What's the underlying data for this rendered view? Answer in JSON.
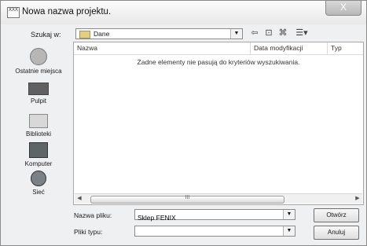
{
  "dialog": {
    "title": "Nowa nazwa projektu.",
    "app_icon_text": "XXX",
    "close_label": "X",
    "look_in_label": "Szukaj w:",
    "look_in_value": "Dane",
    "up_folder_label": "⇦",
    "new_folder_label": "⌘",
    "view_menu_label": "☰▾"
  },
  "places": [
    {
      "label": "Ostatnie miejsca",
      "icon": "recent-places-icon"
    },
    {
      "label": "Pulpit",
      "icon": "desktop-icon"
    },
    {
      "label": "Biblioteki",
      "icon": "libraries-icon"
    },
    {
      "label": "Komputer",
      "icon": "computer-icon"
    },
    {
      "label": "Sieć",
      "icon": "network-icon"
    }
  ],
  "list": {
    "columns": [
      "Nazwa",
      "Data modyfikacji",
      "Typ"
    ],
    "empty_message": "Żadne elementy nie pasują do kryteriów wyszukiwania.",
    "scroll_left": "◀",
    "scroll_right": "▶",
    "thumb_grip": "III"
  },
  "file": {
    "name_label": "Nazwa pliku:",
    "name_value": "Sklep FENIX",
    "type_label": "Pliki typu:",
    "type_value": ""
  },
  "buttons": {
    "open": "Otwórz",
    "cancel": "Anuluj"
  }
}
